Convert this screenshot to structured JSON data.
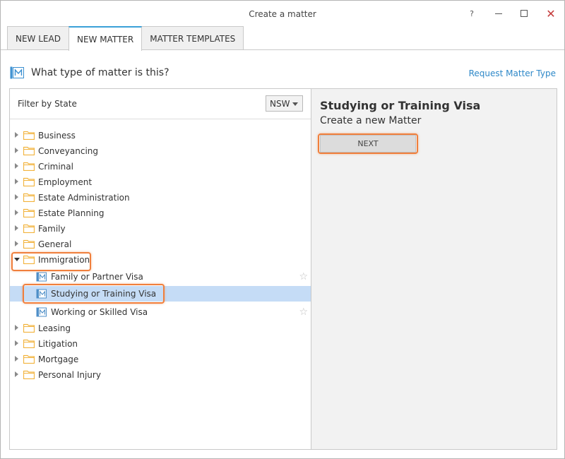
{
  "window": {
    "title": "Create a matter",
    "help_glyph": "?",
    "close_glyph": "✕"
  },
  "tabs": [
    {
      "label": "NEW LEAD",
      "active": false
    },
    {
      "label": "NEW MATTER",
      "active": true
    },
    {
      "label": "MATTER TEMPLATES",
      "active": false
    }
  ],
  "header": {
    "question": "What type of matter is this?",
    "request_link": "Request Matter Type"
  },
  "filter": {
    "label": "Filter by State",
    "state_value": "NSW"
  },
  "tree": {
    "items": [
      {
        "label": "Business"
      },
      {
        "label": "Conveyancing"
      },
      {
        "label": "Criminal"
      },
      {
        "label": "Employment"
      },
      {
        "label": "Estate Administration"
      },
      {
        "label": "Estate Planning"
      },
      {
        "label": "Family"
      },
      {
        "label": "General"
      },
      {
        "label": "Immigration",
        "expanded": true,
        "children": [
          {
            "label": "Family or Partner Visa"
          },
          {
            "label": "Studying or Training Visa",
            "selected": true
          },
          {
            "label": "Working or Skilled Visa"
          }
        ]
      },
      {
        "label": "Leasing"
      },
      {
        "label": "Litigation"
      },
      {
        "label": "Mortgage"
      },
      {
        "label": "Personal Injury"
      }
    ],
    "star_glyph": "☆"
  },
  "detail": {
    "title": "Studying or Training Visa",
    "subtitle": "Create a new Matter",
    "next_label": "NEXT"
  },
  "colors": {
    "accent": "#3aa0d8",
    "link": "#2e88c8",
    "highlight": "#f07f3c",
    "selected_row": "#c5dcf6",
    "folder": "#f2b33d"
  }
}
